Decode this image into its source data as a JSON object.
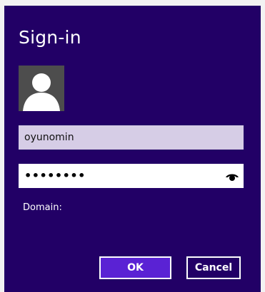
{
  "dialog": {
    "title": "Sign-in",
    "username_value": "oyunomin",
    "password_masked": "••••••••",
    "domain_label": "Domain:",
    "ok_label": "OK",
    "cancel_label": "Cancel",
    "icons": {
      "avatar": "user-avatar-icon",
      "reveal": "eye-icon"
    },
    "colors": {
      "background": "#220066",
      "username_field": "#d6cde6",
      "ok_button": "#5a22d4"
    }
  }
}
